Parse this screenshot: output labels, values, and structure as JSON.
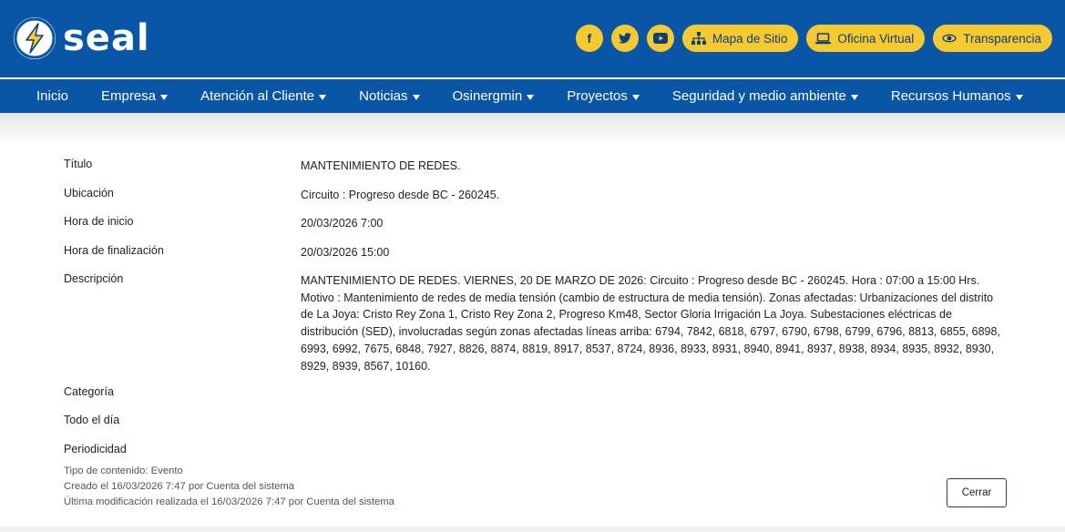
{
  "header": {
    "logo_text": "seal",
    "social": [
      {
        "icon": "facebook-icon",
        "glyph": "f"
      },
      {
        "icon": "twitter-icon",
        "glyph": "t"
      },
      {
        "icon": "youtube-icon",
        "glyph": "▶"
      }
    ],
    "buttons": [
      {
        "label": "Mapa de Sitio",
        "icon": "sitemap-icon"
      },
      {
        "label": "Oficina Virtual",
        "icon": "laptop-icon"
      },
      {
        "label": "Transparencia",
        "icon": "transparency-icon"
      }
    ],
    "colors": {
      "primary": "#0a56a6",
      "accent": "#f6c92f"
    }
  },
  "nav": {
    "items": [
      {
        "label": "Inicio",
        "dropdown": false
      },
      {
        "label": "Empresa",
        "dropdown": true
      },
      {
        "label": "Atención al Cliente",
        "dropdown": true
      },
      {
        "label": "Noticias",
        "dropdown": true
      },
      {
        "label": "Osinergmin",
        "dropdown": true
      },
      {
        "label": "Proyectos",
        "dropdown": true
      },
      {
        "label": "Seguridad y medio ambiente",
        "dropdown": true
      },
      {
        "label": "Recursos Humanos",
        "dropdown": true
      }
    ]
  },
  "event": {
    "fields": [
      {
        "label": "Título",
        "value": "MANTENIMIENTO DE REDES."
      },
      {
        "label": "Ubicación",
        "value": "Circuito : Progreso desde BC - 260245."
      },
      {
        "label": "Hora de inicio",
        "value": "20/03/2026 7:00"
      },
      {
        "label": "Hora de finalización",
        "value": "20/03/2026 15:00"
      },
      {
        "label": "Descripción",
        "value": "MANTENIMIENTO DE REDES. VIERNES, 20 DE MARZO DE 2026: Circuito : Progreso desde BC - 260245. Hora : 07:00 a 15:00 Hrs. Motivo : Mantenimiento de redes de media tensión (cambio de estructura de media tensión). Zonas afectadas: Urbanizaciones del distrito de La Joya: Cristo Rey Zona 1, Cristo Rey Zona 2, Progreso Km48, Sector Gloria Irrigación La Joya. Subestaciones eléctricas de distribución (SED), involucradas según zonas afectadas líneas arriba: 6794, 7842, 6818, 6797, 6790, 6798, 6799, 6796, 8813, 6855, 6898, 6993, 6992, 7675, 6848, 7927, 8826, 8874, 8819, 8917, 8537, 8724, 8936, 8933, 8931, 8940, 8941, 8937, 8938, 8934, 8935, 8932, 8930, 8929, 8939, 8567, 10160."
      },
      {
        "label": "Categoría",
        "value": ""
      },
      {
        "label": "Todo el día",
        "value": ""
      },
      {
        "label": "Periodicidad",
        "value": ""
      }
    ]
  },
  "meta": {
    "content_type": "Tipo de contenido: Evento",
    "created": "Creado el 16/03/2026 7:47 por Cuenta del sistema",
    "modified": "Última modificación realizada el 16/03/2026 7:47 por Cuenta del sistema"
  },
  "actions": {
    "close_label": "Cerrar"
  }
}
